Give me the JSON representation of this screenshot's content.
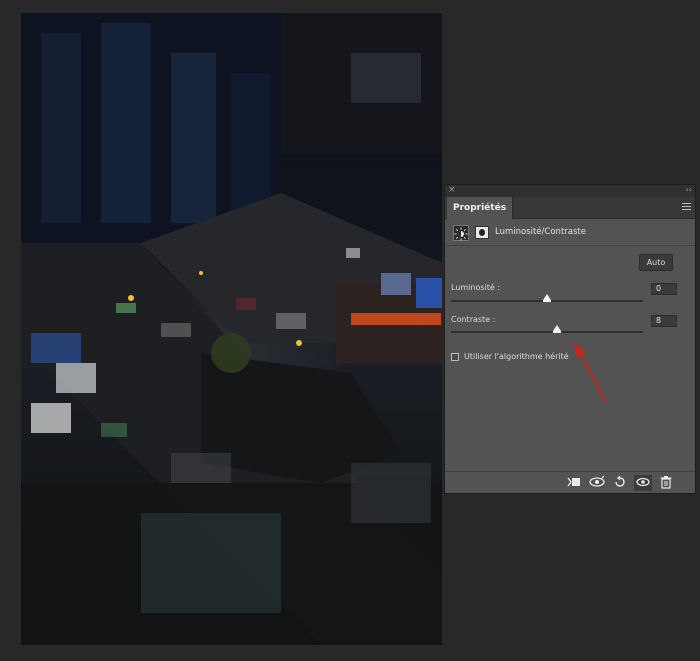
{
  "panel": {
    "close_glyph": "×",
    "collapse_glyph": "‹‹",
    "tab_label": "Propriétés",
    "adjustment_title": "Luminosité/Contraste",
    "auto_label": "Auto",
    "brightness": {
      "label": "Luminosité :",
      "value": "0",
      "level_fraction": 0.5
    },
    "contrast": {
      "label": "Contraste :",
      "value": "8",
      "level_fraction": 0.55
    },
    "legacy_label": "Utiliser l'algorithme hérité",
    "legacy_checked": false
  },
  "footer_icons": [
    "clip-to-layer-icon",
    "view-previous-state-icon",
    "reset-icon",
    "visibility-eye-icon",
    "trash-icon"
  ],
  "colors": {
    "panel_bg": "#535353",
    "canvas_bg": "#282828",
    "arrow": "#c0281e"
  }
}
